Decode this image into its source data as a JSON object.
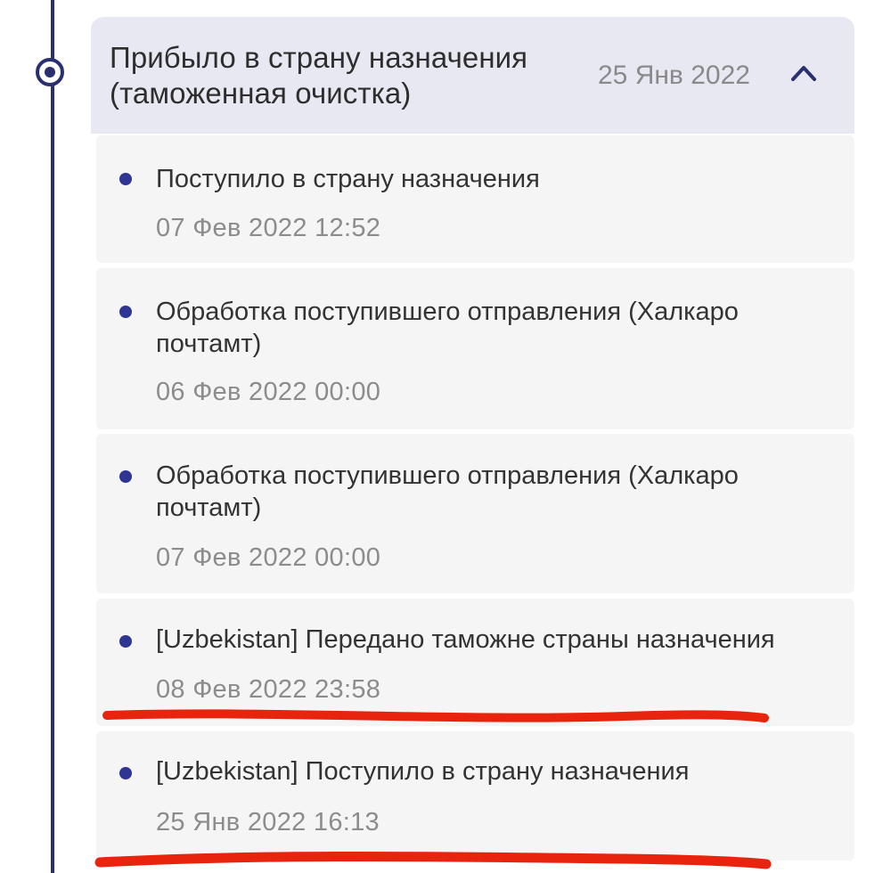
{
  "group": {
    "title": "Прибыло в страну назначения (таможенная очистка)",
    "date": "25 Янв 2022",
    "expanded": true,
    "toggle_icon": "chevron-up-icon"
  },
  "events": [
    {
      "description": "Поступило в страну назначения",
      "time": "07 Фев 2022 12:52"
    },
    {
      "description": "Обработка поступившего отправления (Халкаро почтамт)",
      "time": "06 Фев 2022 00:00"
    },
    {
      "description": "Обработка поступившего отправления (Халкаро почтамт)",
      "time": "07 Фев 2022 00:00"
    },
    {
      "description": "[Uzbekistan] Передано таможне страны назначения",
      "time": "08 Фев 2022 23:58"
    },
    {
      "description": "[Uzbekistan] Поступило в страну назначения",
      "time": "25 Янв 2022 16:13"
    }
  ],
  "colors": {
    "accent": "#2a2f6e",
    "bullet": "#2e3593",
    "header_bg": "#e8e8f3",
    "event_bg": "#f5f5f5",
    "annotation": "#e8230e"
  }
}
